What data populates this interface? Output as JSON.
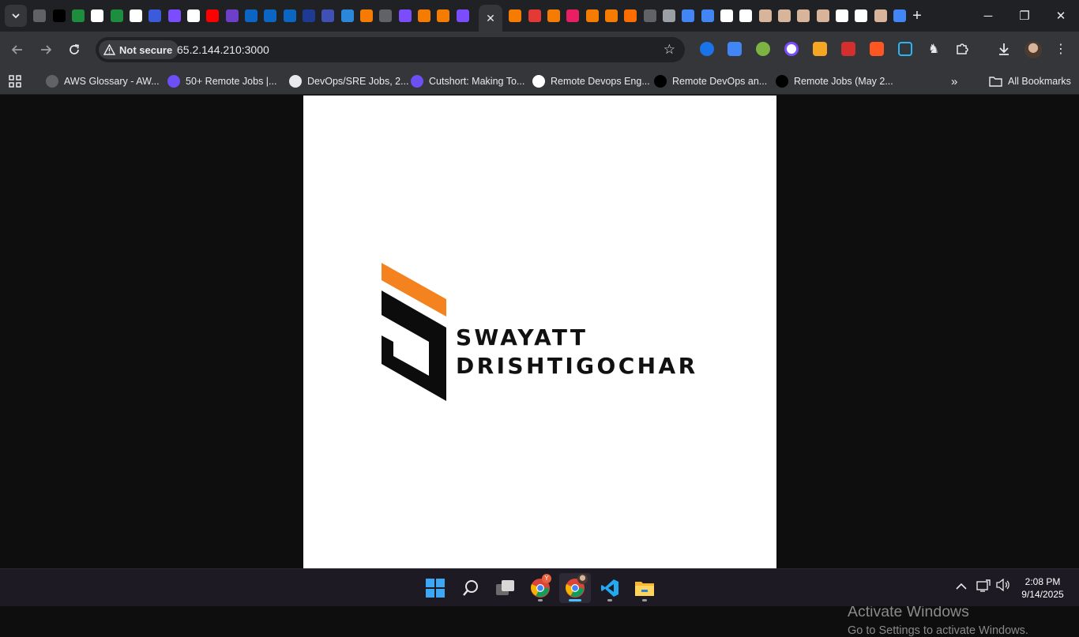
{
  "browser": {
    "tab_strip": {
      "active_tab_close": "✕",
      "new_tab": "+",
      "favicon_colors": [
        "#5f6368",
        "#000000",
        "#1e8e3e",
        "#ffffff",
        "#1e8e3e",
        "#ffffff",
        "#3b5bdb",
        "#7c4dff",
        "#ffffff",
        "#ff0000",
        "#6e40c9",
        "#0a66c2",
        "#0a66c2",
        "#0a66c2",
        "#1f3a93",
        "#3f51b5",
        "#2b88d8",
        "#f57c00",
        "#5f6368",
        "#7c4dff",
        "#f57c00",
        "#f57c00",
        "#7c4dff"
      ],
      "favicon_colors_right": [
        "#f57c00",
        "#e53935",
        "#f57c00",
        "#e91e63",
        "#f57c00",
        "#f57c00",
        "#ff6d00",
        "#5f6368",
        "#9aa0a6",
        "#4285f4",
        "#4285f4",
        "#ffffff",
        "#ffffff",
        "#d7b49a",
        "#d7b49a",
        "#d7b49a",
        "#d7b49a",
        "#ffffff",
        "#ffffff",
        "#d7b49a",
        "#4285f4"
      ]
    },
    "window_controls": {
      "minimize": "─",
      "restore": "❐",
      "close": "✕"
    },
    "toolbar": {
      "security_label": "Not secure",
      "url": "65.2.144.210:3000"
    },
    "bookmarks": [
      {
        "label": "AWS Glossary - AW...",
        "color": "#5f6368"
      },
      {
        "label": "50+ Remote Jobs |...",
        "color": "#6e4ff6"
      },
      {
        "label": "DevOps/SRE Jobs, 2...",
        "color": "#e8eaed"
      },
      {
        "label": "Cutshort: Making To...",
        "color": "#6e4ff6"
      },
      {
        "label": "Remote Devops Eng...",
        "color": "#ffffff"
      },
      {
        "label": "Remote DevOps an...",
        "color": "#000000"
      },
      {
        "label": "Remote Jobs (May 2...",
        "color": "#000000"
      }
    ],
    "all_bookmarks": "All Bookmarks"
  },
  "page": {
    "brand_line1": "SWAYATT",
    "brand_line2": "DRISHTIGOCHAR",
    "colors": {
      "accent_orange": "#f4821f",
      "mark_black": "#0c0c0c"
    }
  },
  "watermark": {
    "line1": "Activate Windows",
    "line2": "Go to Settings to activate Windows."
  },
  "taskbar": {
    "chrome_badge": "Y",
    "time": "2:08 PM",
    "date": "9/14/2025"
  }
}
